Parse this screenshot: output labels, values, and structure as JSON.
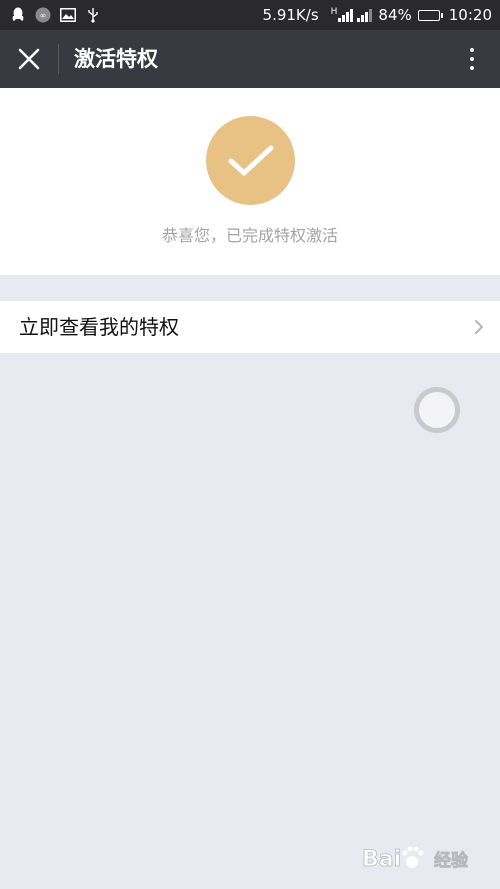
{
  "status_bar": {
    "network_speed": "5.91K/s",
    "signal_label": "H",
    "battery_percent": "84%",
    "battery_level": 0.84,
    "time": "10:20",
    "icons": [
      "qq-icon",
      "app-icon",
      "image-icon",
      "usb-icon",
      "signal-icon",
      "battery-icon"
    ]
  },
  "titlebar": {
    "title": "激活特权",
    "icons": [
      "close-icon",
      "more-vertical-icon"
    ]
  },
  "success": {
    "icon": "check-icon",
    "message": "恭喜您，已完成特权激活",
    "accent_color": "#e8c285"
  },
  "privilege_row": {
    "label": "立即查看我的特权",
    "icon": "chevron-right-icon"
  },
  "watermark": {
    "text": "Baidu经验"
  },
  "colors": {
    "status_bar_bg": "#2a2a2c",
    "title_bar_bg": "#393a3f",
    "page_bg": "#e9eaef",
    "battery_fill": "#3ec23e"
  }
}
